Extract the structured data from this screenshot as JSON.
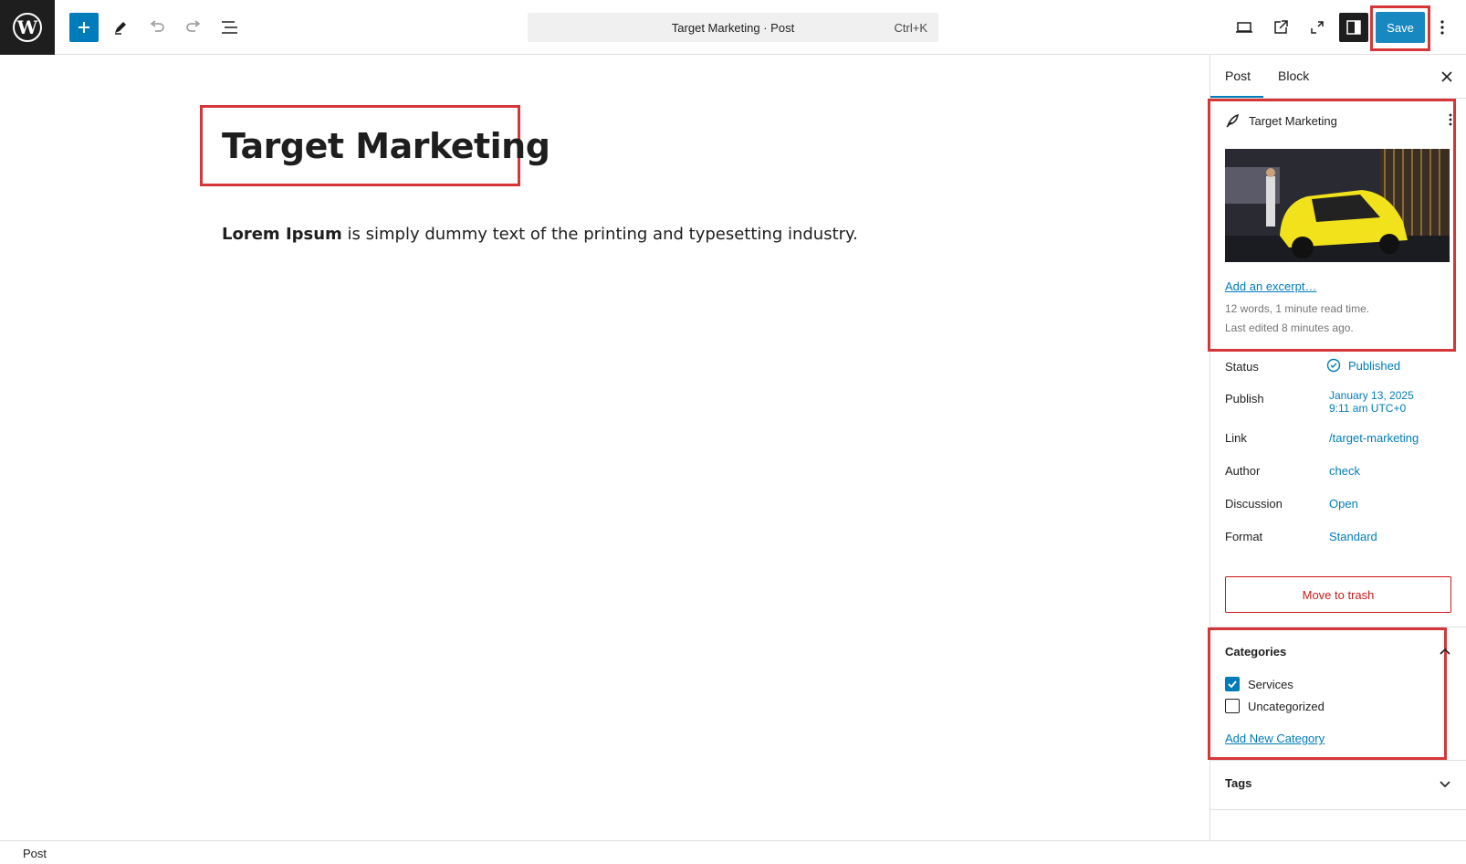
{
  "toolbar": {
    "logo_icon": "wordpress-logo-icon",
    "command_title": "Target Marketing · Post",
    "command_shortcut": "Ctrl+K",
    "save_label": "Save"
  },
  "editor": {
    "title": "Target Marketing",
    "body_bold": "Lorem Ipsum",
    "body_rest": " is simply dummy text of the printing and typesetting industry."
  },
  "sidebar": {
    "tabs": [
      "Post",
      "Block"
    ],
    "post_name": "Target Marketing",
    "excerpt_link": "Add an excerpt…",
    "word_count": "12 words, 1 minute read time.",
    "last_edited": "Last edited 8 minutes ago.",
    "rows": [
      {
        "label": "Status",
        "value": "Published"
      },
      {
        "label": "Publish",
        "value": "January 13, 2025",
        "value2": "9:11 am UTC+0"
      },
      {
        "label": "Link",
        "value": "/target-marketing"
      },
      {
        "label": "Author",
        "value": "check"
      },
      {
        "label": "Discussion",
        "value": "Open"
      },
      {
        "label": "Format",
        "value": "Standard"
      }
    ],
    "trash_label": "Move to trash",
    "categories_title": "Categories",
    "categories": [
      {
        "label": "Services",
        "checked": true
      },
      {
        "label": "Uncategorized",
        "checked": false
      }
    ],
    "add_category_link": "Add New Category",
    "tags_title": "Tags"
  },
  "footer": {
    "breadcrumb": "Post"
  },
  "colors": {
    "accent": "#007cba",
    "highlight": "#d63638",
    "danger": "#cc1818"
  }
}
